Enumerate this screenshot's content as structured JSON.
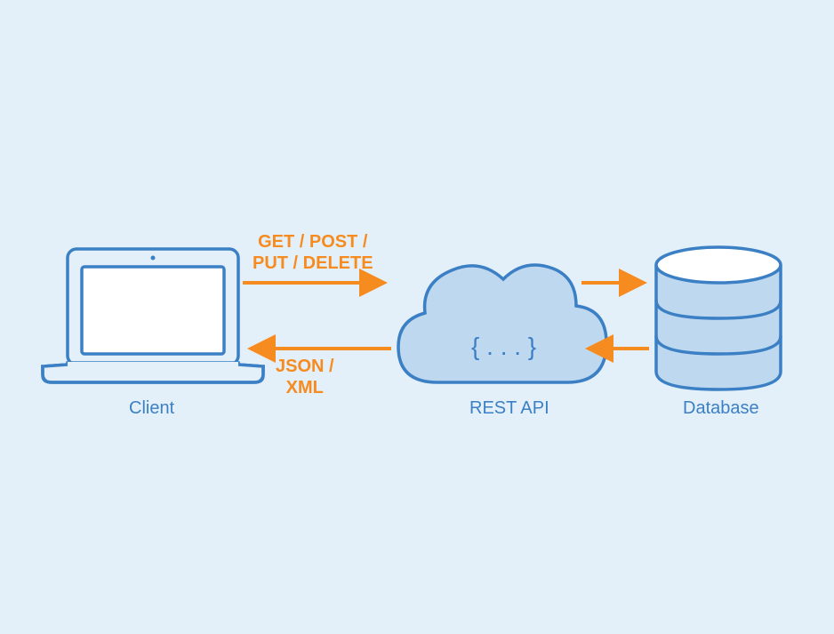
{
  "nodes": {
    "client": {
      "label": "Client"
    },
    "api": {
      "label": "REST API",
      "code": "{ . . . }"
    },
    "database": {
      "label": "Database"
    }
  },
  "arrows": {
    "request": {
      "label_line1": "GET / POST /",
      "label_line2": "PUT / DELETE"
    },
    "response": {
      "label_line1": "JSON /",
      "label_line2": "XML"
    }
  },
  "colors": {
    "bg": "#e3f0fa",
    "blue_line": "#3b7fc4",
    "blue_fill": "#bed8ef",
    "white": "#ffffff",
    "orange": "#f68b1f"
  }
}
